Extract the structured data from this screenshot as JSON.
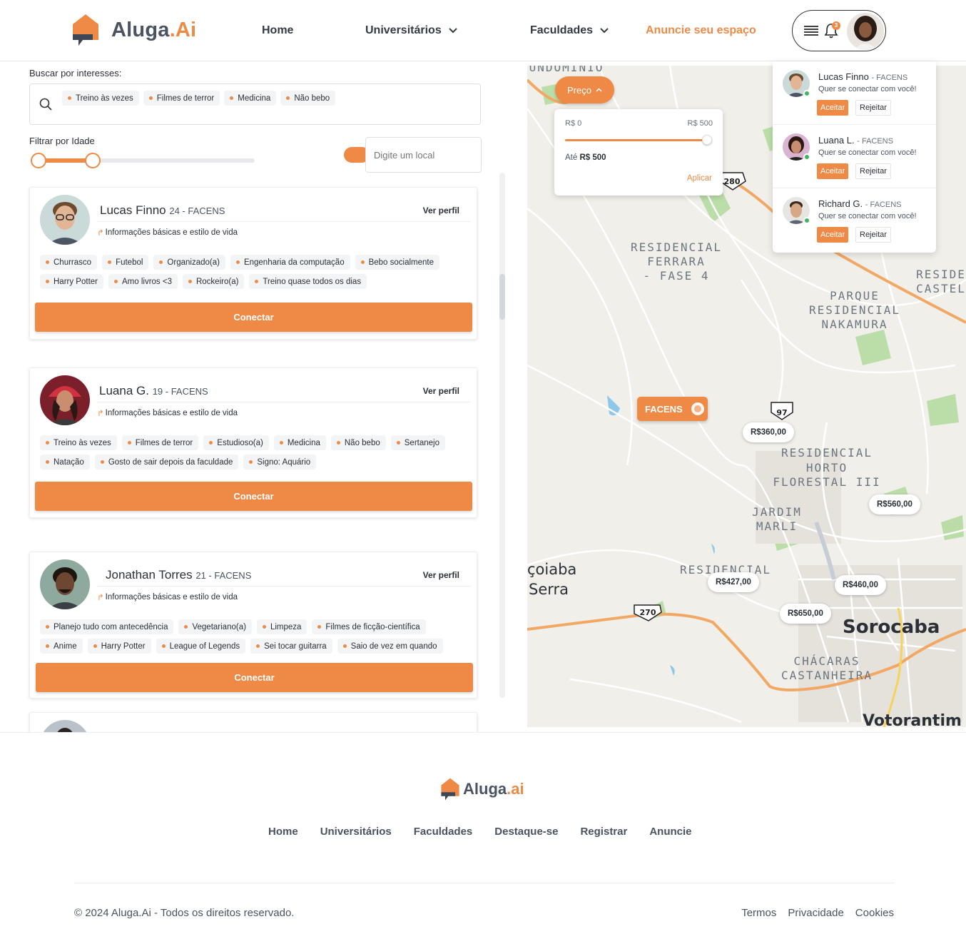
{
  "header": {
    "logo_main": "Aluga",
    "logo_accent": ".Ai",
    "nav": {
      "home": "Home",
      "universitarios": "Universitários",
      "faculdades": "Faculdades",
      "anuncie": "Anuncie seu espaço"
    },
    "notification_count": "3"
  },
  "filters": {
    "search_label": "Buscar por interesses:",
    "tags": [
      "Treino às vezes",
      "Filmes de terror",
      "Medicina",
      "Não bebo"
    ],
    "age_label": "Filtrar por Idade",
    "local_placeholder": "Digite um local"
  },
  "cards": [
    {
      "name": "Lucas Finno",
      "age_school": "24 - FACENS",
      "ver_perfil": "Ver perfil",
      "info": "Informações básicas e estilo de vida",
      "tags_row1": [
        "Churrasco",
        "Futebol",
        "Organizado(a)",
        "Engenharia da computação",
        "Bebo socialmente"
      ],
      "tags_row2": [
        "Harry Potter",
        "Amo livros <3",
        "Rockeiro(a)",
        "Treino quase todos os dias"
      ],
      "button": "Conectar"
    },
    {
      "name": "Luana G.",
      "age_school": "19 - FACENS",
      "ver_perfil": "Ver perfil",
      "info": "Informações básicas e estilo de vida",
      "tags_row1": [
        "Treino às vezes",
        "Filmes de terror",
        "Estudioso(a)",
        "Medicina",
        "Não bebo",
        "Sertanejo"
      ],
      "tags_row2": [
        "Natação",
        "Gosto de sair depois da faculdade",
        "Signo: Aquário"
      ],
      "button": "Conectar"
    },
    {
      "name": "Jonathan Torres",
      "age_school": "21 - FACENS",
      "ver_perfil": "Ver perfil",
      "info": "Informações básicas e estilo de vida",
      "tags_row1": [
        "Planejo tudo com antecedência",
        "Vegetariano(a)",
        "Limpeza",
        "Filmes de ficção-científica"
      ],
      "tags_row2": [
        "Anime",
        "Harry Potter",
        "League of Legends",
        "Sei tocar guitarra",
        "Saio de vez em quando"
      ],
      "button": "Conectar"
    }
  ],
  "map": {
    "price_button": "Preço",
    "price_min": "R$ 0",
    "price_max": "R$ 500",
    "price_upto_label": "Até",
    "price_upto_value": "R$ 500",
    "apply": "Aplicar",
    "faculty": "FACENS",
    "prices": [
      "R$360,00",
      "R$560,00",
      "R$427,00",
      "R$460,00",
      "R$650,00"
    ],
    "places": [
      "RESIDENCIAL",
      "FERRARA",
      "- FASE 4",
      "PARQUE",
      "RESIDENCIAL",
      "NAKAMURA",
      "RESIDENCIAL",
      "HORTO",
      "FLORESTAL III",
      "JARDIM",
      "MARLI",
      "Sorocaba",
      "Votorantim",
      "CHÁCARAS",
      "CASTANHEIRA",
      "çoiaba",
      "Serra",
      "RESIDENCIAL",
      "RESIDE",
      "CASTEL",
      "UNDOMINIO",
      "280",
      "97",
      "270"
    ]
  },
  "notifications": [
    {
      "name": "Lucas Finno",
      "school": "- FACENS",
      "message": "Quer se conectar com você!",
      "accept": "Aceitar",
      "reject": "Rejeitar"
    },
    {
      "name": "Luana L.",
      "school": "- FACENS",
      "message": "Quer se conectar com você!",
      "accept": "Aceitar",
      "reject": "Rejeitar"
    },
    {
      "name": "Richard G.",
      "school": "- FACENS",
      "message": "Quer se conectar com você!",
      "accept": "Aceitar",
      "reject": "Rejeitar"
    }
  ],
  "footer": {
    "logo_main": "Aluga",
    "logo_accent": ".ai",
    "nav": [
      "Home",
      "Universitários",
      "Faculdades",
      "Destaque-se",
      "Registrar",
      "Anuncie"
    ],
    "copyright": "© 2024 Aluga.Ai - Todos os direitos reservado.",
    "links": [
      "Termos",
      "Privacidade",
      "Cookies"
    ]
  },
  "colors": {
    "accent": "#ee8a45",
    "text": "#2b2f36",
    "online": "#3cb55e"
  }
}
